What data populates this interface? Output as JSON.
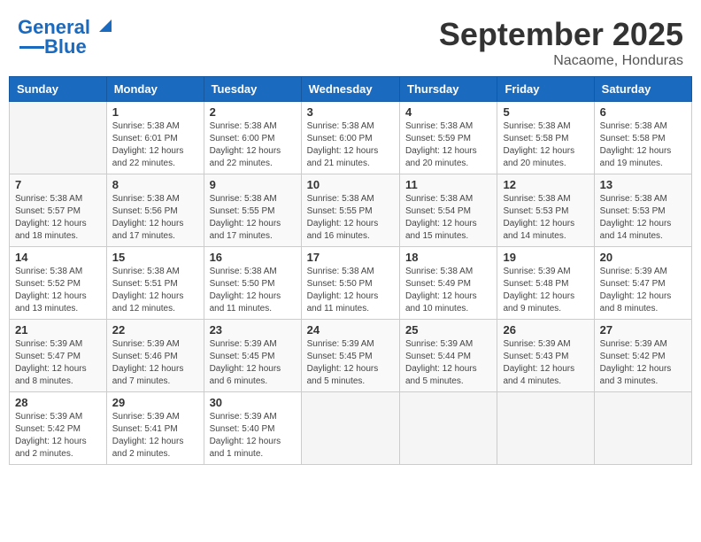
{
  "header": {
    "logo_line1": "General",
    "logo_line2": "Blue",
    "month": "September 2025",
    "location": "Nacaome, Honduras"
  },
  "days_of_week": [
    "Sunday",
    "Monday",
    "Tuesday",
    "Wednesday",
    "Thursday",
    "Friday",
    "Saturday"
  ],
  "weeks": [
    [
      {
        "day": "",
        "info": ""
      },
      {
        "day": "1",
        "info": "Sunrise: 5:38 AM\nSunset: 6:01 PM\nDaylight: 12 hours\nand 22 minutes."
      },
      {
        "day": "2",
        "info": "Sunrise: 5:38 AM\nSunset: 6:00 PM\nDaylight: 12 hours\nand 22 minutes."
      },
      {
        "day": "3",
        "info": "Sunrise: 5:38 AM\nSunset: 6:00 PM\nDaylight: 12 hours\nand 21 minutes."
      },
      {
        "day": "4",
        "info": "Sunrise: 5:38 AM\nSunset: 5:59 PM\nDaylight: 12 hours\nand 20 minutes."
      },
      {
        "day": "5",
        "info": "Sunrise: 5:38 AM\nSunset: 5:58 PM\nDaylight: 12 hours\nand 20 minutes."
      },
      {
        "day": "6",
        "info": "Sunrise: 5:38 AM\nSunset: 5:58 PM\nDaylight: 12 hours\nand 19 minutes."
      }
    ],
    [
      {
        "day": "7",
        "info": "Sunrise: 5:38 AM\nSunset: 5:57 PM\nDaylight: 12 hours\nand 18 minutes."
      },
      {
        "day": "8",
        "info": "Sunrise: 5:38 AM\nSunset: 5:56 PM\nDaylight: 12 hours\nand 17 minutes."
      },
      {
        "day": "9",
        "info": "Sunrise: 5:38 AM\nSunset: 5:55 PM\nDaylight: 12 hours\nand 17 minutes."
      },
      {
        "day": "10",
        "info": "Sunrise: 5:38 AM\nSunset: 5:55 PM\nDaylight: 12 hours\nand 16 minutes."
      },
      {
        "day": "11",
        "info": "Sunrise: 5:38 AM\nSunset: 5:54 PM\nDaylight: 12 hours\nand 15 minutes."
      },
      {
        "day": "12",
        "info": "Sunrise: 5:38 AM\nSunset: 5:53 PM\nDaylight: 12 hours\nand 14 minutes."
      },
      {
        "day": "13",
        "info": "Sunrise: 5:38 AM\nSunset: 5:53 PM\nDaylight: 12 hours\nand 14 minutes."
      }
    ],
    [
      {
        "day": "14",
        "info": "Sunrise: 5:38 AM\nSunset: 5:52 PM\nDaylight: 12 hours\nand 13 minutes."
      },
      {
        "day": "15",
        "info": "Sunrise: 5:38 AM\nSunset: 5:51 PM\nDaylight: 12 hours\nand 12 minutes."
      },
      {
        "day": "16",
        "info": "Sunrise: 5:38 AM\nSunset: 5:50 PM\nDaylight: 12 hours\nand 11 minutes."
      },
      {
        "day": "17",
        "info": "Sunrise: 5:38 AM\nSunset: 5:50 PM\nDaylight: 12 hours\nand 11 minutes."
      },
      {
        "day": "18",
        "info": "Sunrise: 5:38 AM\nSunset: 5:49 PM\nDaylight: 12 hours\nand 10 minutes."
      },
      {
        "day": "19",
        "info": "Sunrise: 5:39 AM\nSunset: 5:48 PM\nDaylight: 12 hours\nand 9 minutes."
      },
      {
        "day": "20",
        "info": "Sunrise: 5:39 AM\nSunset: 5:47 PM\nDaylight: 12 hours\nand 8 minutes."
      }
    ],
    [
      {
        "day": "21",
        "info": "Sunrise: 5:39 AM\nSunset: 5:47 PM\nDaylight: 12 hours\nand 8 minutes."
      },
      {
        "day": "22",
        "info": "Sunrise: 5:39 AM\nSunset: 5:46 PM\nDaylight: 12 hours\nand 7 minutes."
      },
      {
        "day": "23",
        "info": "Sunrise: 5:39 AM\nSunset: 5:45 PM\nDaylight: 12 hours\nand 6 minutes."
      },
      {
        "day": "24",
        "info": "Sunrise: 5:39 AM\nSunset: 5:45 PM\nDaylight: 12 hours\nand 5 minutes."
      },
      {
        "day": "25",
        "info": "Sunrise: 5:39 AM\nSunset: 5:44 PM\nDaylight: 12 hours\nand 5 minutes."
      },
      {
        "day": "26",
        "info": "Sunrise: 5:39 AM\nSunset: 5:43 PM\nDaylight: 12 hours\nand 4 minutes."
      },
      {
        "day": "27",
        "info": "Sunrise: 5:39 AM\nSunset: 5:42 PM\nDaylight: 12 hours\nand 3 minutes."
      }
    ],
    [
      {
        "day": "28",
        "info": "Sunrise: 5:39 AM\nSunset: 5:42 PM\nDaylight: 12 hours\nand 2 minutes."
      },
      {
        "day": "29",
        "info": "Sunrise: 5:39 AM\nSunset: 5:41 PM\nDaylight: 12 hours\nand 2 minutes."
      },
      {
        "day": "30",
        "info": "Sunrise: 5:39 AM\nSunset: 5:40 PM\nDaylight: 12 hours\nand 1 minute."
      },
      {
        "day": "",
        "info": ""
      },
      {
        "day": "",
        "info": ""
      },
      {
        "day": "",
        "info": ""
      },
      {
        "day": "",
        "info": ""
      }
    ]
  ]
}
